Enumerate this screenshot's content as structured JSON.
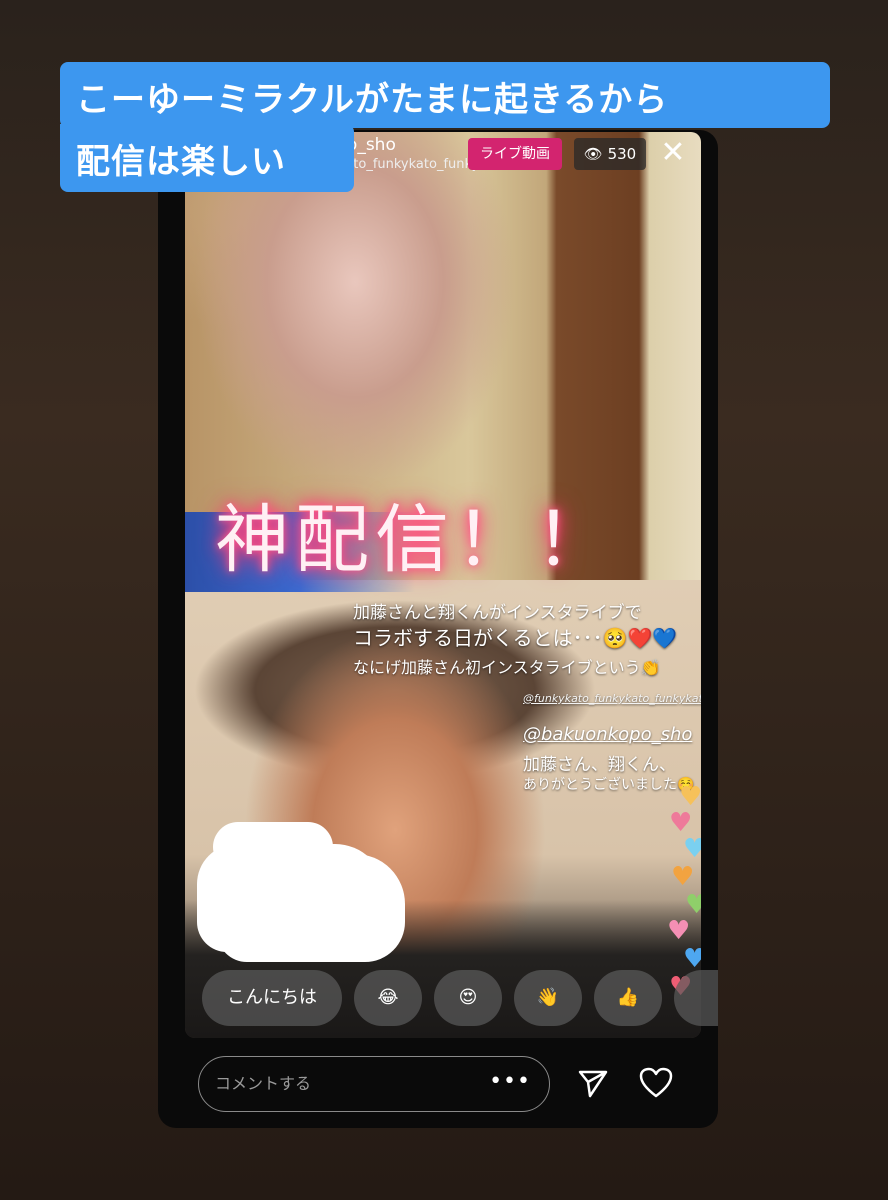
{
  "caption": {
    "line1": "こーゆーミラクルがたまに起きるから",
    "line2": "配信は楽しい"
  },
  "header": {
    "username": "zo_sho",
    "guest": "kato_funkykato_funkykato",
    "live_label": "ライブ動画",
    "viewer_count": "530"
  },
  "overlay": {
    "kami_text": "神配信！！",
    "line1": "加藤さんと翔くんがインスタライブで",
    "line2": "コラボする日がくるとは･･･🥺❤️💙",
    "line3": "なにげ加藤さん初インスタライブという👏",
    "mention_small": "@funkykato_funkykato_funkykato",
    "mention": "@bakuonkopo_sho",
    "thanks1": "加藤さん、翔くん、",
    "thanks2": "ありがとうございました☺️"
  },
  "quick_replies": [
    "こんにちは",
    "😂",
    "😍",
    "👋",
    "👍"
  ],
  "comment": {
    "placeholder": "コメントする",
    "more_label": "•••"
  },
  "colors": {
    "caption_bg": "#3d97ef",
    "live_badge": "#d3246f"
  }
}
